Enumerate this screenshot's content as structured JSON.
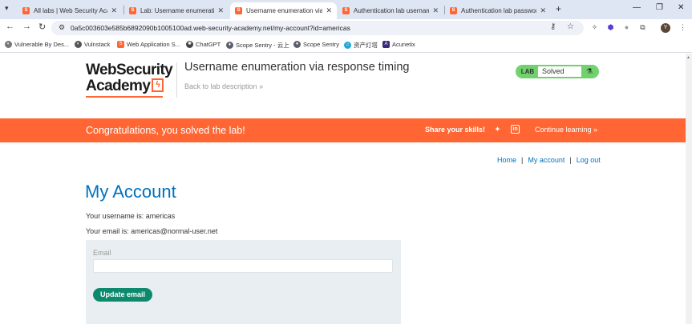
{
  "browser": {
    "tabs": [
      {
        "title": "All labs | Web Security Academy"
      },
      {
        "title": "Lab: Username enumeration via"
      },
      {
        "title": "Username enumeration via response"
      },
      {
        "title": "Authentication lab usernames"
      },
      {
        "title": "Authentication lab passwords"
      }
    ],
    "new_tab": "+",
    "url": "0a5c003603e585b6892090b1005100ad.web-security-academy.net/my-account?id=americas",
    "bookmarks": [
      {
        "label": "Vulnerable By Des...",
        "icon": "globe-icon"
      },
      {
        "label": "Vulnstack",
        "icon": "globe-icon"
      },
      {
        "label": "Web Application S...",
        "icon": "portswigger-icon"
      },
      {
        "label": "ChatGPT",
        "icon": "chatgpt-icon"
      },
      {
        "label": "Scope Sentry - 云上",
        "icon": "scope-sentry-icon"
      },
      {
        "label": "Scope Sentry",
        "icon": "scope-sentry-icon"
      },
      {
        "label": "资产灯塔",
        "icon": "lighthouse-icon"
      },
      {
        "label": "Acunetix",
        "icon": "acunetix-icon"
      }
    ],
    "profile_initial": "Y"
  },
  "header": {
    "logo_line1": "WebSecurity",
    "logo_line2": "Academy",
    "lab_title": "Username enumeration via response timing",
    "back_link": "Back to lab description",
    "back_chevron": "»",
    "lab_tag": "LAB",
    "lab_status": "Solved"
  },
  "banner": {
    "congrats": "Congratulations, you solved the lab!",
    "share": "Share your skills!",
    "continue": "Continue learning",
    "continue_chevron": "»",
    "color": "#ff6633"
  },
  "nav": {
    "home": "Home",
    "my_account": "My account",
    "log_out": "Log out",
    "separator": "|"
  },
  "account": {
    "title": "My Account",
    "username_line": "Your username is: americas",
    "email_line": "Your email is: americas@normal-user.net",
    "email_label": "Email",
    "email_value": "",
    "update_button": "Update email"
  },
  "colors": {
    "accent_orange": "#ff6633",
    "link_blue": "#0071bc",
    "lab_green": "#70d16d",
    "button_green": "#0d8a6e"
  }
}
